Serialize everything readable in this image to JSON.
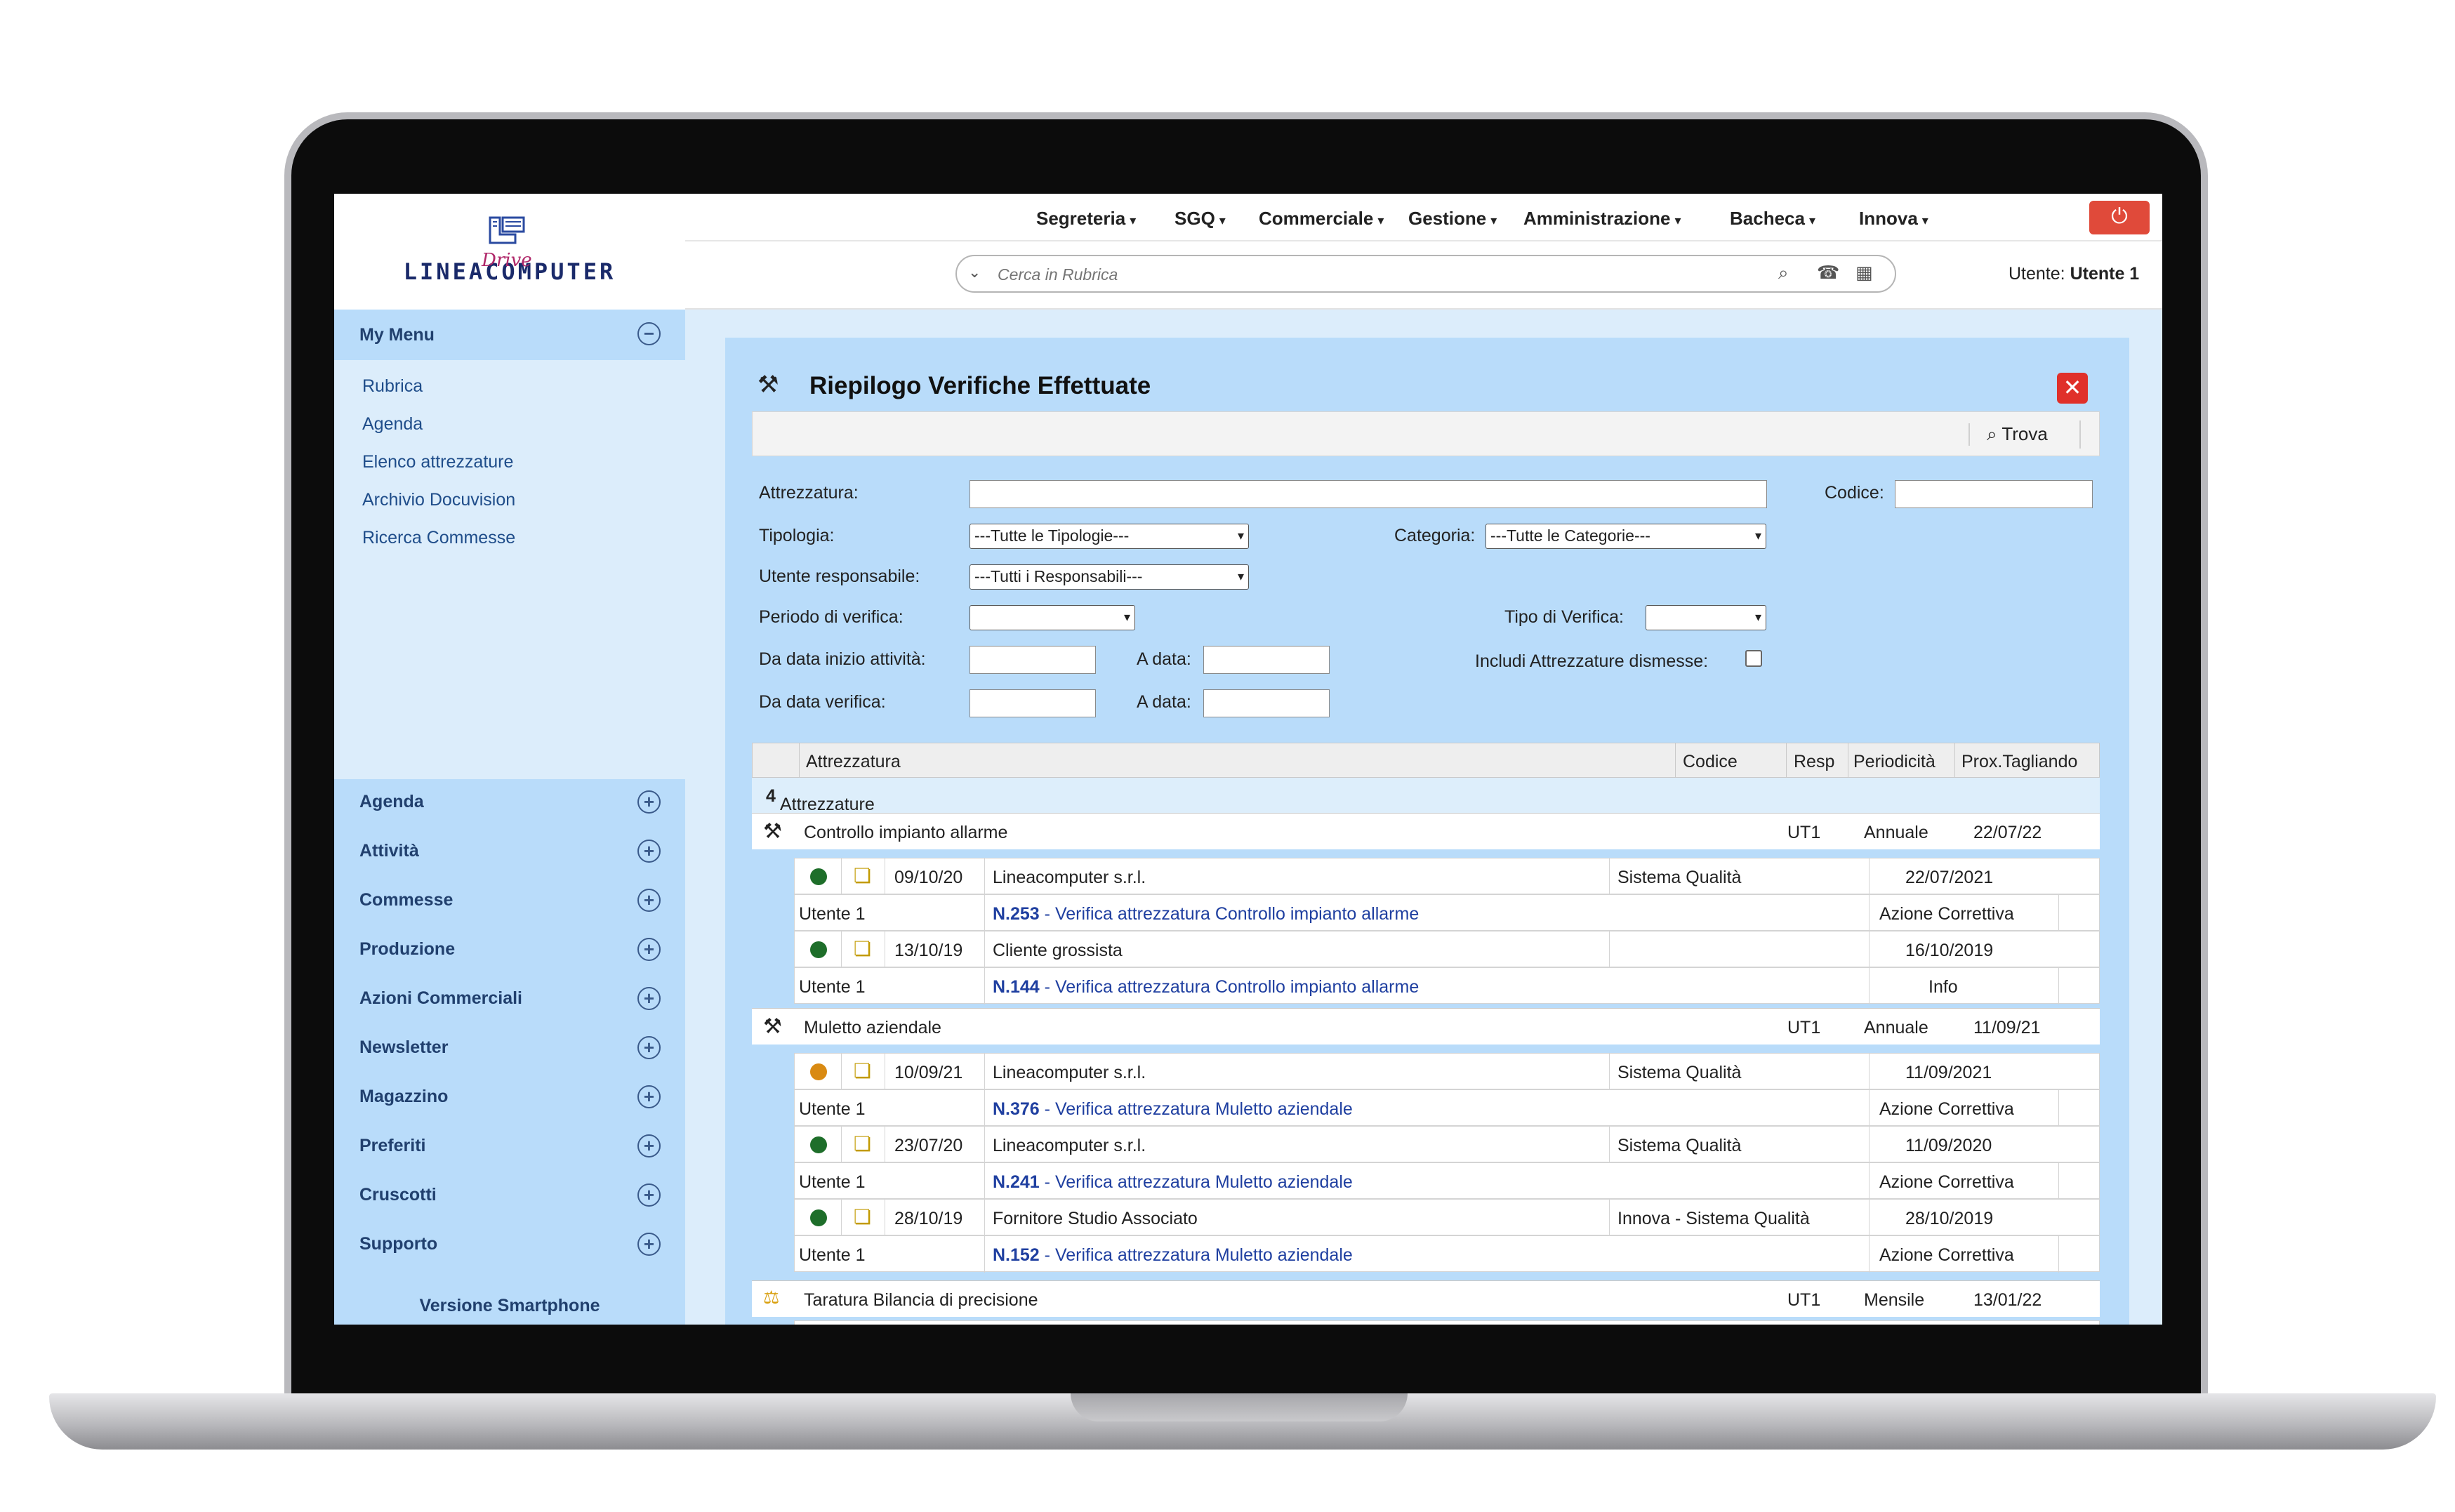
{
  "app": {
    "logo_text": "LINEACOMPUTER",
    "logo_sub": "Drive",
    "user_label": "Utente:",
    "user_name": "Utente 1",
    "search_placeholder": "Cerca in Rubrica",
    "version_link": "Versione Smartphone"
  },
  "nav": [
    "Segreteria",
    "SGQ",
    "Commerciale",
    "Gestione",
    "Amministrazione",
    "Bacheca",
    "Innova"
  ],
  "sidebar": {
    "my_menu": "My Menu",
    "my_menu_items": [
      "Rubrica",
      "Agenda",
      "Elenco attrezzature",
      "Archivio Docuvision",
      "Ricerca Commesse"
    ],
    "sections": [
      "Agenda",
      "Attività",
      "Commesse",
      "Produzione",
      "Azioni Commerciali",
      "Newsletter",
      "Magazzino",
      "Preferiti",
      "Cruscotti",
      "Supporto"
    ]
  },
  "panel": {
    "title": "Riepilogo Verifiche Effettuate",
    "find_button": "Trova"
  },
  "filters": {
    "attrezzatura": "Attrezzatura:",
    "codice": "Codice:",
    "tipologia": "Tipologia:",
    "tipologia_value": "---Tutte le Tipologie---",
    "categoria": "Categoria:",
    "categoria_value": "---Tutte le Categorie---",
    "utente_responsabile": "Utente responsabile:",
    "utente_value": "---Tutti i Responsabili---",
    "periodo": "Periodo di verifica:",
    "tipo_verifica": "Tipo di Verifica:",
    "da_data_inizio": "Da data inizio attività:",
    "a_data": "A data:",
    "da_data_verifica": "Da data verifica:",
    "includi_dismesse": "Includi Attrezzature dismesse:"
  },
  "table": {
    "headers": [
      "Attrezzatura",
      "Codice",
      "Resp",
      "Periodicità",
      "Prox.Tagliando"
    ],
    "count_number": "4",
    "count_label": "Attrezzature trovate",
    "groups": [
      {
        "name": "Controllo impianto allarme",
        "resp": "UT1",
        "periodicity": "Annuale",
        "next": "22/07/22",
        "entries": [
          {
            "status": "green",
            "date": "09/10/20",
            "company": "Lineacomputer s.r.l.",
            "category": "Sistema Qualità",
            "due": "22/07/2021",
            "due_color": "green",
            "user": "Utente 1",
            "num": "N.253",
            "desc": "Verifica attrezzatura Controllo impianto allarme",
            "type": "Azione Correttiva"
          },
          {
            "status": "green",
            "date": "13/10/19",
            "company": "Cliente grossista",
            "category": "",
            "due": "16/10/2019",
            "due_color": "green",
            "user": "Utente 1",
            "num": "N.144",
            "desc": "Verifica attrezzatura Controllo impianto allarme",
            "type": "Info"
          }
        ]
      },
      {
        "name": "Muletto aziendale",
        "resp": "UT1",
        "periodicity": "Annuale",
        "next": "11/09/21",
        "entries": [
          {
            "status": "orange",
            "date": "10/09/21",
            "company": "Lineacomputer s.r.l.",
            "category": "Sistema Qualità",
            "due": "11/09/2021",
            "due_color": "amber",
            "user": "Utente 1",
            "num": "N.376",
            "desc": "Verifica attrezzatura Muletto aziendale",
            "type": "Azione Correttiva"
          },
          {
            "status": "green",
            "date": "23/07/20",
            "company": "Lineacomputer s.r.l.",
            "category": "Sistema Qualità",
            "due": "11/09/2020",
            "due_color": "green",
            "user": "Utente 1",
            "num": "N.241",
            "desc": "Verifica attrezzatura Muletto aziendale",
            "type": "Azione Correttiva"
          },
          {
            "status": "green",
            "date": "28/10/19",
            "company": "Fornitore Studio Associato",
            "category": "Innova - Sistema Qualità",
            "due": "28/10/2019",
            "due_color": "green",
            "user": "Utente 1",
            "num": "N.152",
            "desc": "Verifica attrezzatura Muletto aziendale",
            "type": "Azione Correttiva"
          }
        ]
      },
      {
        "name": "Taratura Bilancia di precisione",
        "resp": "UT1",
        "periodicity": "Mensile",
        "next": "13/01/22",
        "entries": []
      }
    ]
  },
  "icons": {
    "tools": "hammer-wrench-icon",
    "doc": "document-stack-icon",
    "power": "power-icon",
    "close": "close-icon",
    "search": "magnifier-icon",
    "phone": "phone-icon",
    "calendar": "calendar-icon",
    "scale": "scale-icon"
  },
  "colors": {
    "power": "#e04a3a",
    "close": "#e0302a",
    "status_green": "#1e6e2a",
    "status_orange": "#d98a12",
    "panel_bg": "#b9dcfa",
    "sidebar_bg": "#dcedfb"
  }
}
